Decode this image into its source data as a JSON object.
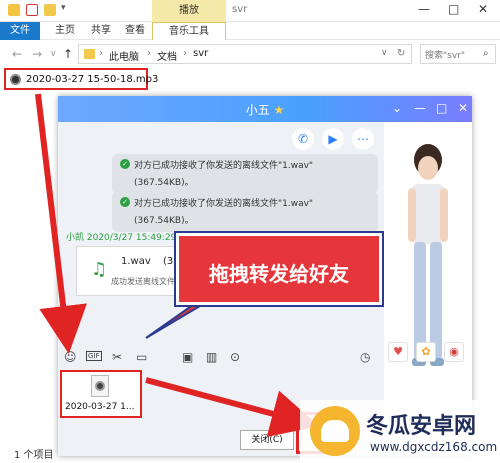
{
  "explorer": {
    "window_title": "svr",
    "contextual_tab": "播放",
    "ribbon_tabs": [
      "文件",
      "主页",
      "共享",
      "查看",
      "音乐工具"
    ],
    "breadcrumb": [
      "此电脑",
      "文档",
      "svr"
    ],
    "search_placeholder": "搜索\"svr\"",
    "selected_file": "2020-03-27 15-50-18.mp3",
    "status_count": "1 个项目"
  },
  "chat": {
    "title": "小五",
    "messages": [
      {
        "line1": "对方已成功接收了你发送的离线文件\"1.wav\"",
        "line2": "(367.54KB)。"
      },
      {
        "line1": "对方已成功接收了你发送的离线文件\"1.wav\"",
        "line2": "(367.54KB)。"
      }
    ],
    "sender_line": "小凯 2020/3/27 15:49:29",
    "file_card": {
      "name": "1.wav",
      "size": "(307.5",
      "status": "成功发送离线文件"
    },
    "attached_file_label": "2020-03-27 1...",
    "close_button": "关闭(C)",
    "toolbar_icons": [
      "smile-icon",
      "gif-icon",
      "scissors-icon",
      "folder-icon",
      "image-icon",
      "video-icon",
      "more-icon",
      "history-icon"
    ]
  },
  "annotation": {
    "callout_text": "拖拽转发给好友"
  },
  "watermark": {
    "title": "冬瓜安卓网",
    "url": "www.dgxcdz168.com"
  },
  "colors": {
    "annotation_red": "#e02424",
    "chat_header": "#4aa0ff",
    "explorer_file_tab": "#1979ca"
  }
}
